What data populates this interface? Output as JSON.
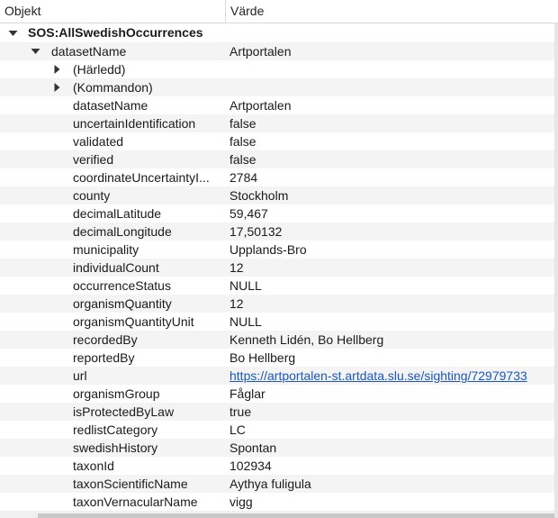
{
  "columns": {
    "object": "Objekt",
    "value": "Värde"
  },
  "root": {
    "label": "SOS:AllSwedishOccurrences",
    "expanded": true
  },
  "dataset": {
    "name": "datasetName",
    "value": "Artportalen",
    "expanded": true
  },
  "groups": [
    {
      "label": "(Härledd)",
      "expanded": false
    },
    {
      "label": "(Kommandon)",
      "expanded": false
    }
  ],
  "properties": [
    {
      "name": "datasetName",
      "value": "Artportalen"
    },
    {
      "name": "uncertainIdentification",
      "value": "false"
    },
    {
      "name": "validated",
      "value": "false"
    },
    {
      "name": "verified",
      "value": "false"
    },
    {
      "name": "coordinateUncertaintyI...",
      "value": "2784"
    },
    {
      "name": "county",
      "value": "Stockholm"
    },
    {
      "name": "decimalLatitude",
      "value": "59,467"
    },
    {
      "name": "decimalLongitude",
      "value": "17,50132"
    },
    {
      "name": "municipality",
      "value": "Upplands-Bro"
    },
    {
      "name": "individualCount",
      "value": "12"
    },
    {
      "name": "occurrenceStatus",
      "value": "NULL"
    },
    {
      "name": "organismQuantity",
      "value": "12"
    },
    {
      "name": "organismQuantityUnit",
      "value": "NULL"
    },
    {
      "name": "recordedBy",
      "value": "Kenneth Lidén, Bo Hellberg"
    },
    {
      "name": "reportedBy",
      "value": "Bo Hellberg"
    },
    {
      "name": "url",
      "value": "https://artportalen-st.artdata.slu.se/sighting/72979733"
    },
    {
      "name": "organismGroup",
      "value": "Fåglar"
    },
    {
      "name": "isProtectedByLaw",
      "value": "true"
    },
    {
      "name": "redlistCategory",
      "value": "LC"
    },
    {
      "name": "swedishHistory",
      "value": "Spontan"
    },
    {
      "name": "taxonId",
      "value": "102934"
    },
    {
      "name": "taxonScientificName",
      "value": "Aythya fuligula"
    },
    {
      "name": "taxonVernacularName",
      "value": "vigg"
    }
  ],
  "colors": {
    "link": "#1a56c9",
    "alt_row": "#f4f4f4",
    "grid": "#d9d9d9"
  },
  "icons": {
    "expanded": "triangle-down-icon",
    "collapsed": "triangle-right-icon"
  }
}
